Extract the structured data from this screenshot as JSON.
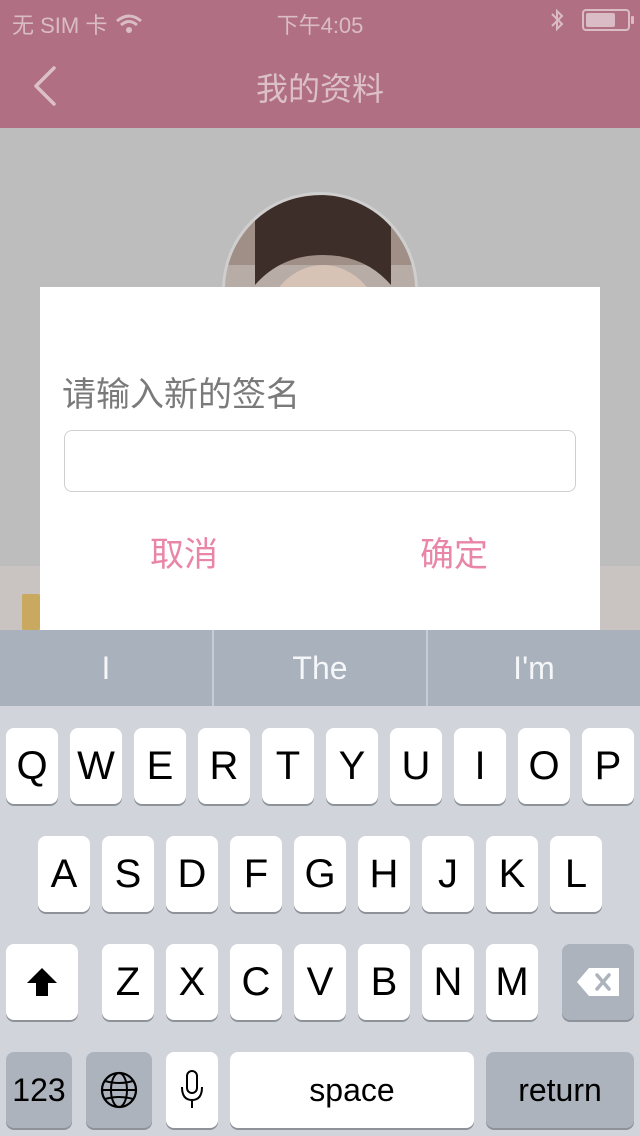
{
  "status_bar": {
    "carrier": "无 SIM 卡",
    "time": "下午4:05",
    "battery_level": 0.8
  },
  "nav": {
    "title": "我的资料",
    "back_icon": "chevron-left-icon"
  },
  "dialog": {
    "prompt": "请输入新的签名",
    "input_value": "",
    "cancel_label": "取消",
    "confirm_label": "确定",
    "accent_color": "#e985a7"
  },
  "suggestions": [
    "I",
    "The",
    "I'm"
  ],
  "keyboard": {
    "row1": [
      "Q",
      "W",
      "E",
      "R",
      "T",
      "Y",
      "U",
      "I",
      "O",
      "P"
    ],
    "row2": [
      "A",
      "S",
      "D",
      "F",
      "G",
      "H",
      "J",
      "K",
      "L"
    ],
    "row3": [
      "Z",
      "X",
      "C",
      "V",
      "B",
      "N",
      "M"
    ],
    "numbers_label": "123",
    "space_label": "space",
    "return_label": "return"
  },
  "colors": {
    "header": "#b16f83",
    "overlay_bg": "#bdbdbd",
    "keyboard_bg": "#d1d5db"
  }
}
